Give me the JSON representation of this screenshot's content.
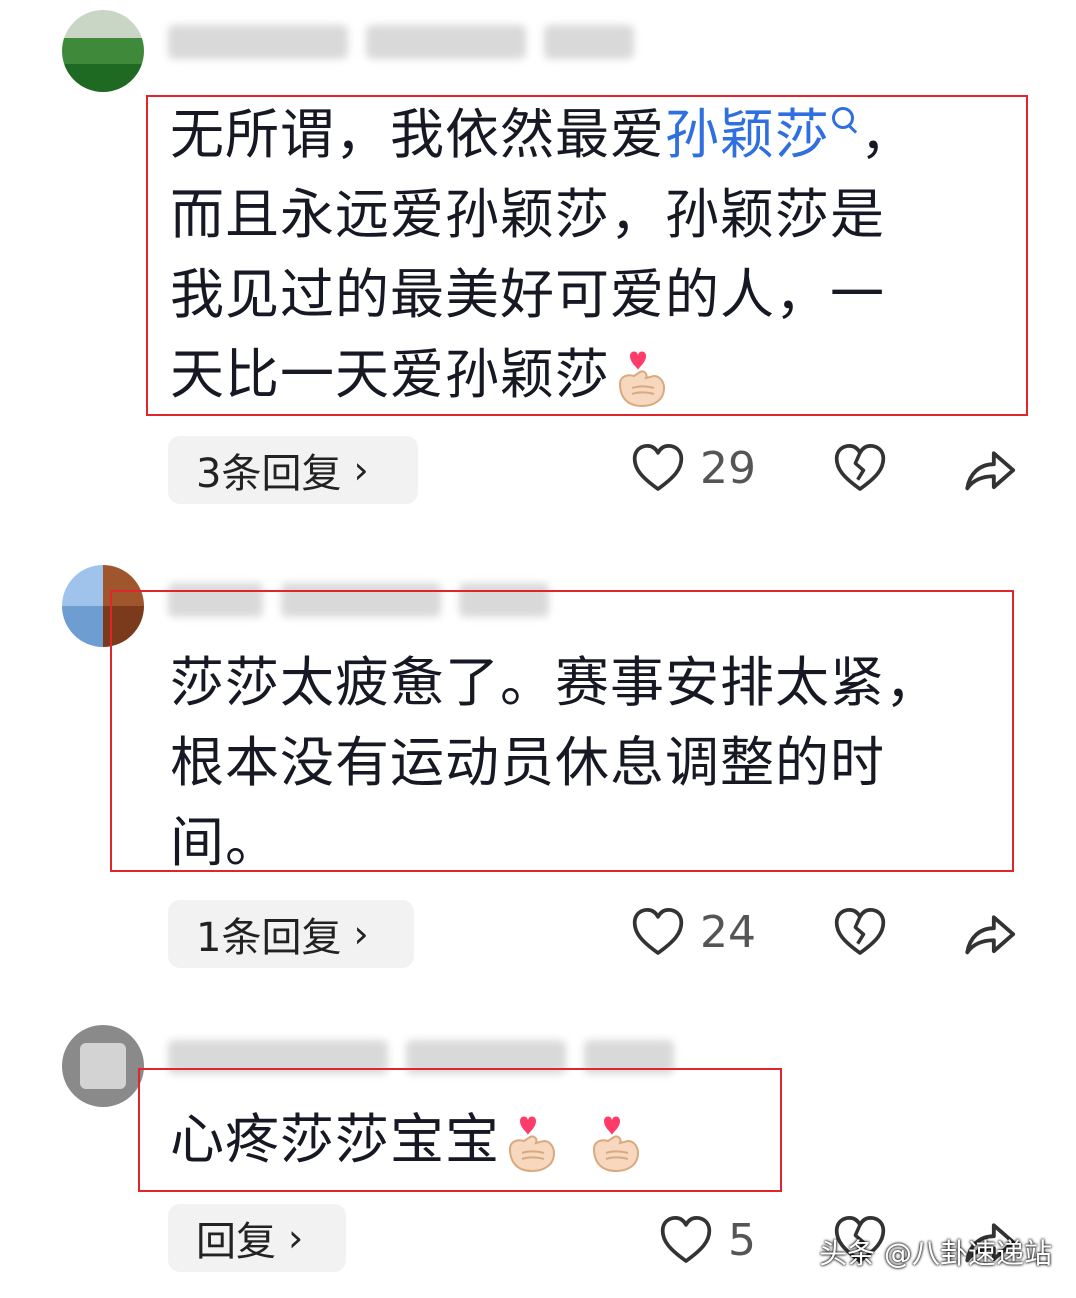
{
  "comments": [
    {
      "lines": [
        "无所谓，我依然最爱",
        "而且永远爱孙颖莎，孙颖莎是",
        "我见过的最美好可爱的人，一",
        "天比一天爱孙颖莎"
      ],
      "link_text": "孙颖莎",
      "trailing_comma": "，",
      "emoji": [
        "finger-heart"
      ],
      "reply_label": "3条回复",
      "like_count": "29"
    },
    {
      "lines": [
        "莎莎太疲惫了。赛事安排太紧，",
        "根本没有运动员休息调整的时",
        "间。"
      ],
      "reply_label": "1条回复",
      "like_count": "24"
    },
    {
      "lines": [
        "心疼莎莎宝宝"
      ],
      "emoji": [
        "finger-heart",
        "finger-heart"
      ],
      "reply_label": "回复",
      "like_count": "5"
    }
  ],
  "icons": {
    "like": "heart-outline-icon",
    "dislike": "broken-heart-icon",
    "share": "share-arrow-icon",
    "reply_chevron": "chevron-right-icon"
  },
  "watermark": "头条 @八卦速递站",
  "colors": {
    "highlight_box": "#e0262c",
    "link": "#2f6fe0",
    "text": "#161823",
    "pill_bg": "#f2f2f3"
  }
}
